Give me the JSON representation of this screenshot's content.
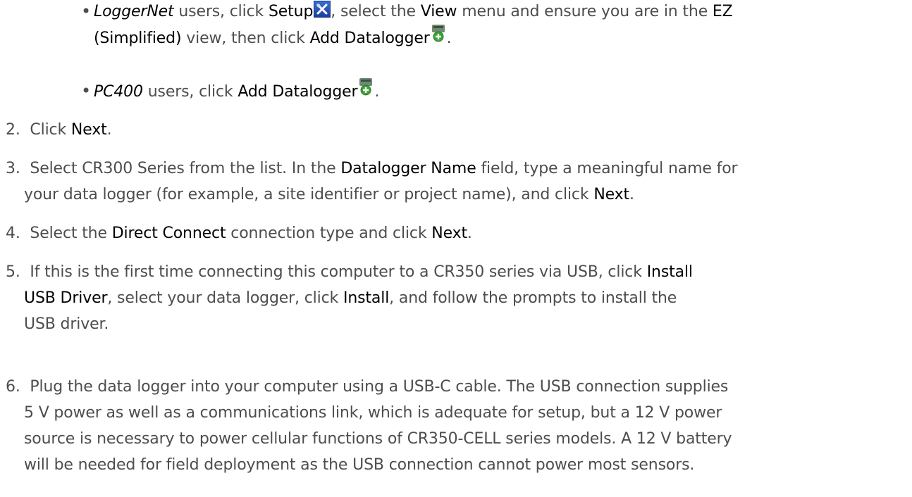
{
  "bullets": [
    {
      "lead": "LoggerNet",
      "t1": " users, click ",
      "setup": "Setup",
      "t2": ", select the ",
      "view": "View",
      "t3": " menu and ensure you are in the ",
      "ez": "EZ",
      "simplified": "(Simplified)",
      "t4": " view, then click ",
      "add": "Add Datalogger",
      "end": "."
    },
    {
      "lead": "PC400",
      "t1": " users, click ",
      "add": "Add Datalogger",
      "end": "."
    }
  ],
  "steps": [
    {
      "n": "2.",
      "a": "Click ",
      "b1": "Next",
      "c": "."
    },
    {
      "n": "3.",
      "a": "Select CR300 Series from the list. In the ",
      "b1": "Datalogger Name",
      "c": " field, type a meaningful name for",
      "line2a": "your data logger (for example, a site identifier or project name), and click ",
      "b2": "Next",
      "line2b": "."
    },
    {
      "n": "4.",
      "a": "Select the ",
      "b1": "Direct Connect",
      "c": " connection type and click ",
      "b2": "Next",
      "d": "."
    },
    {
      "n": "5.",
      "a": "If this is the first time connecting this computer to a CR350 series via USB, click ",
      "b1": "Install",
      "b1b": "USB Driver",
      "c": ", select your data logger, click ",
      "b2": "Install",
      "d": ", and follow the prompts to install the",
      "e": "USB driver."
    },
    {
      "n": "6.",
      "l1": "Plug the data logger into your computer using a USB-C cable. The USB connection supplies",
      "l2": "5 V power as well as a communications link, which is adequate for setup, but a 12 V power",
      "l3": "source is necessary to power cellular functions of CR350-CELL series models. A 12 V battery",
      "l4": "will be needed for field deployment as the USB connection cannot power most sensors."
    }
  ],
  "icons": [
    "setup-icon",
    "add-datalogger-icon"
  ],
  "colors": {
    "text": "#4d4d4d",
    "bold": "#000000",
    "setup_icon": "#2a55c4"
  }
}
